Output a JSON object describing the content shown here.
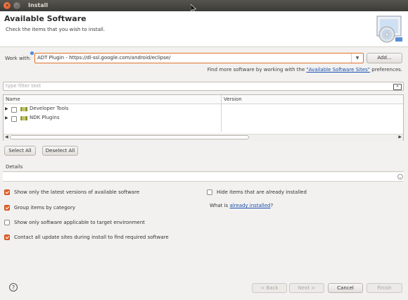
{
  "window": {
    "title": "Install"
  },
  "header": {
    "title": "Available Software",
    "subtitle": "Check the items that you wish to install."
  },
  "work_with": {
    "label": "Work with:",
    "value": "ADT Plugin - https://dl-ssl.google.com/android/eclipse/",
    "add_button": "Add..."
  },
  "more_software": {
    "prefix": "Find more software by working with the ",
    "link": "\"Available Software Sites\"",
    "suffix": " preferences."
  },
  "filter": {
    "placeholder": "type filter text"
  },
  "tree": {
    "columns": [
      "Name",
      "Version"
    ],
    "rows": [
      {
        "label": "Developer Tools",
        "version": "",
        "checked": false
      },
      {
        "label": "NDK Plugins",
        "version": "",
        "checked": false
      }
    ]
  },
  "selection": {
    "select_all": "Select All",
    "deselect_all": "Deselect All"
  },
  "details": {
    "label": "Details"
  },
  "options": {
    "latest_versions": {
      "label": "Show only the latest versions of available software",
      "checked": true
    },
    "group_by_category": {
      "label": "Group items by category",
      "checked": true
    },
    "applicable_only": {
      "label": "Show only software applicable to target environment",
      "checked": false
    },
    "contact_sites": {
      "label": "Contact all update sites during install to find required software",
      "checked": true
    },
    "hide_installed": {
      "label": "Hide items that are already installed",
      "checked": false
    },
    "what_is": {
      "prefix": "What is ",
      "link": "already installed",
      "suffix": "?"
    }
  },
  "footer": {
    "back": "< Back",
    "next": "Next >",
    "cancel": "Cancel",
    "finish": "Finish"
  },
  "colors": {
    "accent": "#e9662c",
    "link": "#1a4fb0"
  }
}
